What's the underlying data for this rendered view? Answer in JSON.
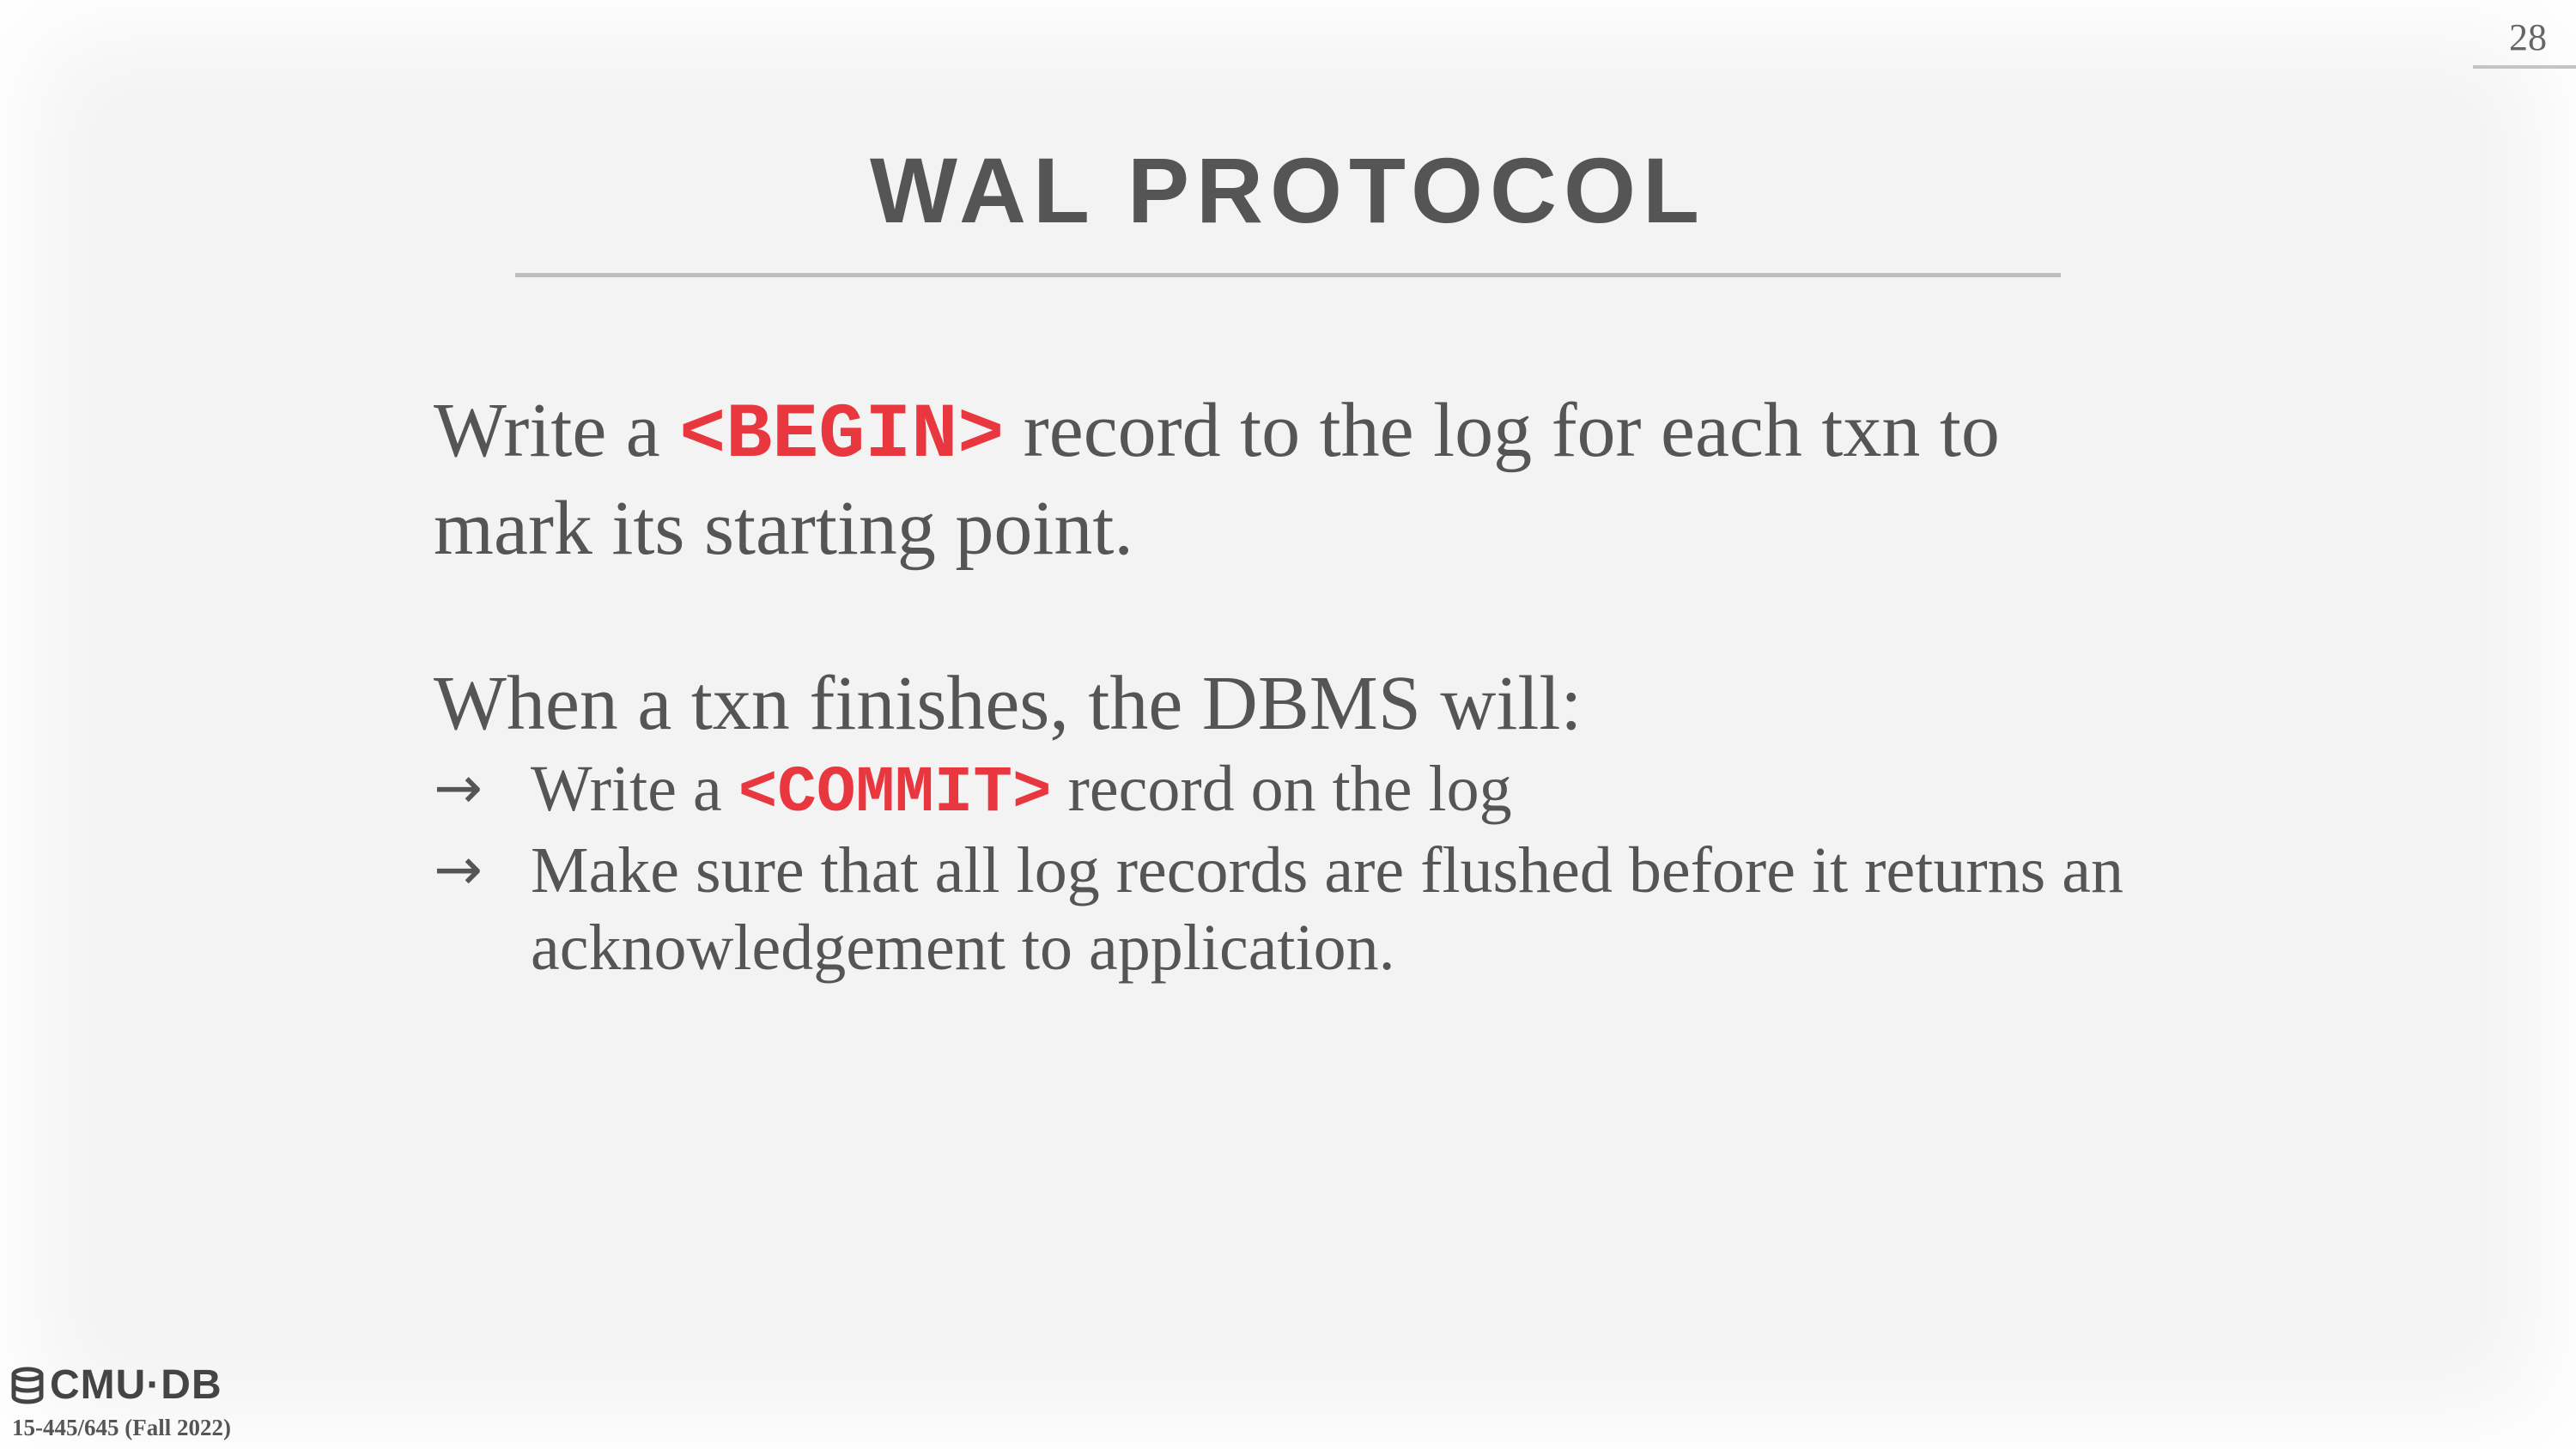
{
  "slide": {
    "page_number": "28",
    "title": "WAL PROTOCOL",
    "paragraph1": {
      "before": "Write a ",
      "code": "<BEGIN>",
      "after": " record to the log for each txn to mark its starting point."
    },
    "paragraph2": "When a txn finishes, the DBMS will:",
    "bullets": [
      {
        "arrow": "→",
        "before": "Write a ",
        "code": "<COMMIT>",
        "after": " record on the log"
      },
      {
        "arrow": "→",
        "text": "Make sure that all log records are flushed before it returns an acknowledgement to application."
      }
    ]
  },
  "footer": {
    "logo_icon": "database-icon",
    "logo_text": "CMU·DB",
    "course": "15-445/645 (Fall 2022)"
  },
  "colors": {
    "background": "#f3f3f3",
    "text": "#555555",
    "code_accent": "#e8373f"
  }
}
